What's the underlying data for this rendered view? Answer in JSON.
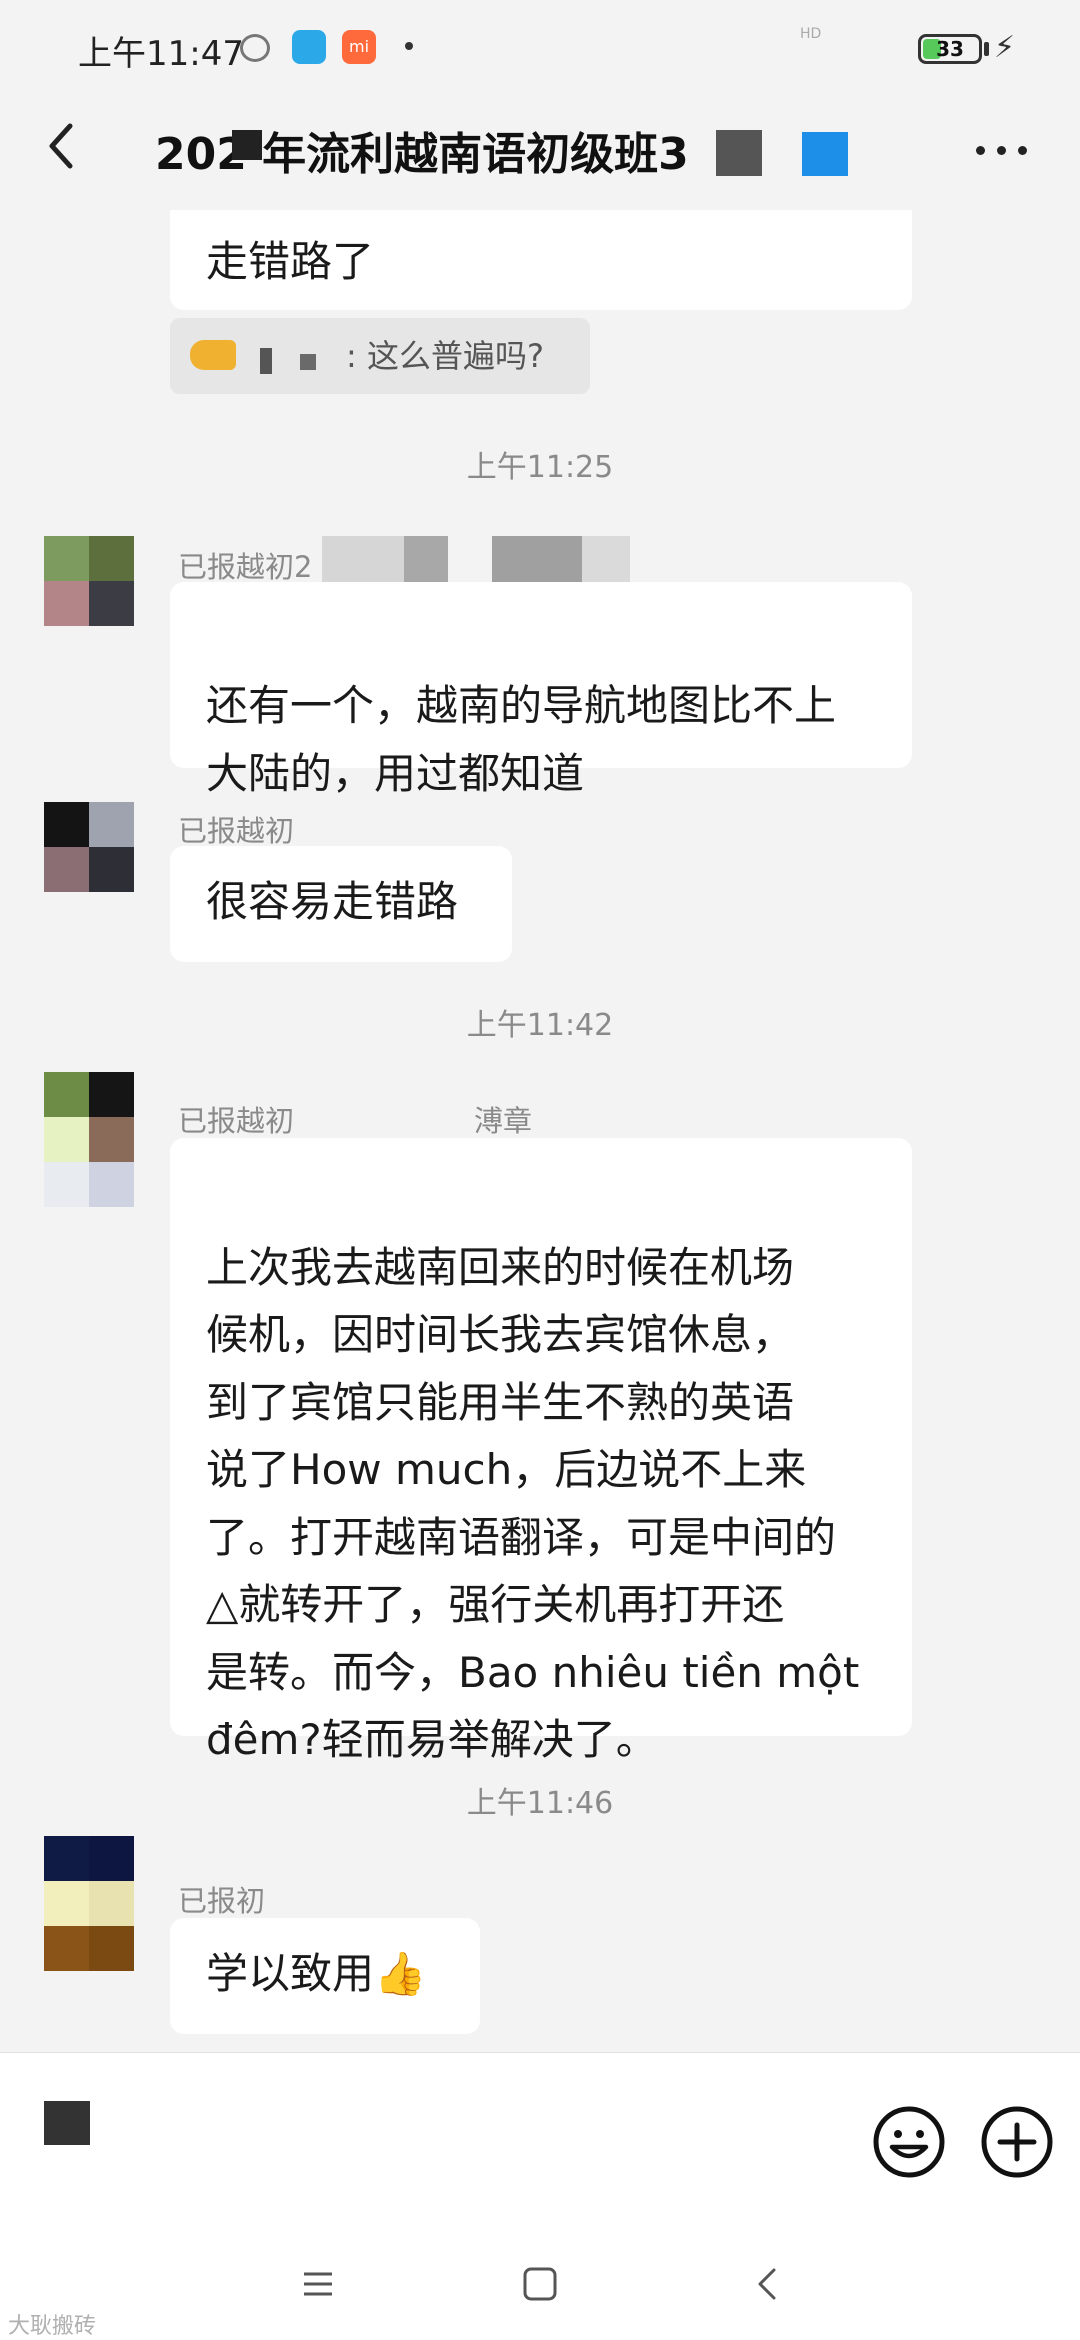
{
  "status_bar": {
    "time": "上午11:47",
    "hd": "HD",
    "battery": "33",
    "battery_level": 0.33,
    "mi_label": "mi"
  },
  "header": {
    "title": "202  年流利越南语初级班3",
    "back_icon": "chevron-left-icon",
    "more_icon": "more-dots-icon"
  },
  "messages": {
    "m1": {
      "text": "走错路了"
    },
    "quote": {
      "text": ": 这么普遍吗?"
    },
    "t1": "上午11:25",
    "m2": {
      "sender": "已报越初2",
      "text": "还有一个，越南的导航地图比不上\n大陆的，用过都知道"
    },
    "m3": {
      "sender": "已报越初",
      "text": "很容易走错路"
    },
    "t2": "上午11:42",
    "m4": {
      "sender": "已报越初",
      "sender_suffix": "溥章",
      "text": "上次我去越南回来的时候在机场\n候机，因时间长我去宾馆休息，\n到了宾馆只能用半生不熟的英语\n说了How much，后边说不上来\n了。打开越南语翻译，可是中间的\n△就转开了，强行关机再打开还\n是转。而今，Bao nhiêu tiền một\nđêm?轻而易举解决了。"
    },
    "t3": "上午11:46",
    "m5": {
      "sender": "已报初",
      "text": "学以致用👍"
    }
  },
  "input_bar": {
    "emoji_icon": "smiley-icon",
    "plus_icon": "plus-circle-icon"
  },
  "nav_bar": {
    "menu_icon": "menu-icon",
    "home_icon": "square-home-icon",
    "back_icon": "back-triangle-icon"
  },
  "watermark": "大耿搬砖"
}
